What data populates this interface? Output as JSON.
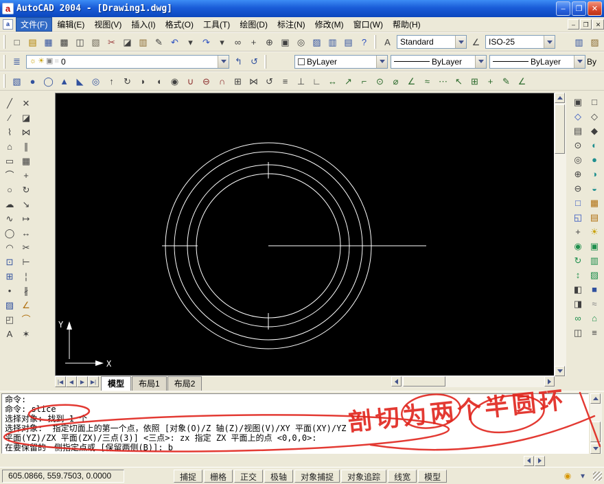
{
  "colors": {
    "titlebar_blue": "#0b47bd",
    "chrome": "#ece9d8",
    "canvas_black": "#000000",
    "annotation_red": "#e0251d",
    "menu_highlight": "#316ac5"
  },
  "title_bar": {
    "title": "AutoCAD 2004 - [Drawing1.dwg]",
    "app_logo_letter": "a"
  },
  "window_controls": {
    "minimize_glyph": "–",
    "restore_glyph": "❐",
    "close_glyph": "✕"
  },
  "menu_bar": {
    "items": [
      {
        "name": "file",
        "label": "文件(F)",
        "highlighted": true
      },
      {
        "name": "edit",
        "label": "编辑(E)"
      },
      {
        "name": "view",
        "label": "视图(V)"
      },
      {
        "name": "insert",
        "label": "插入(I)"
      },
      {
        "name": "format",
        "label": "格式(O)"
      },
      {
        "name": "tools",
        "label": "工具(T)"
      },
      {
        "name": "draw",
        "label": "绘图(D)"
      },
      {
        "name": "dimension",
        "label": "标注(N)"
      },
      {
        "name": "modify",
        "label": "修改(M)"
      },
      {
        "name": "window",
        "label": "窗口(W)"
      },
      {
        "name": "help",
        "label": "帮助(H)"
      }
    ]
  },
  "toolbar_standard": {
    "icons": [
      {
        "name": "new-file",
        "glyph": "□",
        "color": "#404040"
      },
      {
        "name": "open-folder",
        "glyph": "▤",
        "color": "#b08000"
      },
      {
        "name": "save",
        "glyph": "▦",
        "color": "#31519e"
      },
      {
        "name": "plot",
        "glyph": "▩",
        "color": "#404040"
      },
      {
        "name": "print-preview",
        "glyph": "◫",
        "color": "#404040"
      },
      {
        "name": "publish",
        "glyph": "▧",
        "color": "#706a5a"
      },
      {
        "name": "cut",
        "glyph": "✂",
        "color": "#9a3b3b"
      },
      {
        "name": "copy",
        "glyph": "◪",
        "color": "#404040"
      },
      {
        "name": "paste",
        "glyph": "▥",
        "color": "#8a6a30"
      },
      {
        "name": "match-properties",
        "glyph": "✎",
        "color": "#404040"
      },
      {
        "name": "undo",
        "glyph": "↶",
        "color": "#2b4fc0"
      },
      {
        "name": "undo-dropdown",
        "glyph": "▾",
        "color": "#404040"
      },
      {
        "name": "redo",
        "glyph": "↷",
        "color": "#2b4fc0"
      },
      {
        "name": "redo-dropdown",
        "glyph": "▾",
        "color": "#404040"
      },
      {
        "name": "insert-hyperlink",
        "glyph": "∞",
        "color": "#404040"
      },
      {
        "name": "pan-realtime",
        "glyph": "+",
        "color": "#404040"
      },
      {
        "name": "zoom-realtime",
        "glyph": "⊕",
        "color": "#404040"
      },
      {
        "name": "zoom-window",
        "glyph": "▣",
        "color": "#404040"
      },
      {
        "name": "zoom-previous",
        "glyph": "◎",
        "color": "#404040"
      },
      {
        "name": "adcenter",
        "glyph": "▨",
        "color": "#31519e"
      },
      {
        "name": "properties",
        "glyph": "▥",
        "color": "#31519e"
      },
      {
        "name": "tool-palettes",
        "glyph": "▤",
        "color": "#31519e"
      },
      {
        "name": "help",
        "glyph": "?",
        "color": "#2b4fc0"
      }
    ],
    "text_style_icon_glyph": "A",
    "text_style_label": "Standard",
    "dim_style_icon_glyph": "∠",
    "dim_style_label": "ISO-25",
    "overflow_icons": [
      {
        "name": "sheet-set-manager",
        "glyph": "▥",
        "color": "#31519e"
      },
      {
        "name": "markup-set-manager",
        "glyph": "▨",
        "color": "#8a6a30"
      }
    ]
  },
  "toolbar_layers": {
    "icons_left": [
      {
        "name": "layer-properties-manager",
        "glyph": "≣",
        "color": "#31519e"
      }
    ],
    "layer_combo": {
      "state_icons": [
        {
          "name": "layer-on-bulb",
          "glyph": "☼",
          "color": "#c8a000"
        },
        {
          "name": "layer-freeze-sun",
          "glyph": "☀",
          "color": "#c8a000"
        },
        {
          "name": "layer-lock",
          "glyph": "▣",
          "color": "#848484"
        },
        {
          "name": "layer-color-swatch",
          "glyph": "■",
          "color": "#e8e8e8"
        }
      ],
      "value": "0"
    },
    "icons_mid": [
      {
        "name": "make-objects-layer-current",
        "glyph": "↰",
        "color": "#31519e"
      },
      {
        "name": "layer-previous",
        "glyph": "↺",
        "color": "#31519e"
      }
    ],
    "color_combo": {
      "swatch_color": "#ffffff",
      "value": "ByLayer"
    },
    "linetype_combo": {
      "value": "ByLayer"
    },
    "lineweight_combo": {
      "value": "ByLayer"
    },
    "plot_style_fragment": "By"
  },
  "toolbar_row3": {
    "icons": [
      {
        "name": "solid-box",
        "glyph": "▧",
        "color": "#31519e"
      },
      {
        "name": "solid-sphere",
        "glyph": "●",
        "color": "#31519e"
      },
      {
        "name": "solid-cylinder",
        "glyph": "◯",
        "color": "#31519e"
      },
      {
        "name": "solid-cone",
        "glyph": "▲",
        "color": "#31519e"
      },
      {
        "name": "solid-wedge",
        "glyph": "◣",
        "color": "#31519e"
      },
      {
        "name": "solid-torus",
        "glyph": "◎",
        "color": "#31519e"
      },
      {
        "name": "extrude",
        "glyph": "↑",
        "color": "#404040"
      },
      {
        "name": "revolve",
        "glyph": "↻",
        "color": "#404040"
      },
      {
        "name": "slice",
        "glyph": "◗",
        "color": "#404040"
      },
      {
        "name": "section",
        "glyph": "◖",
        "color": "#404040"
      },
      {
        "name": "interfere",
        "glyph": "◉",
        "color": "#404040"
      },
      {
        "name": "union",
        "glyph": "∪",
        "color": "#8a2a2a"
      },
      {
        "name": "subtract",
        "glyph": "⊖",
        "color": "#8a2a2a"
      },
      {
        "name": "intersect",
        "glyph": "∩",
        "color": "#8a2a2a"
      },
      {
        "name": "3d-array",
        "glyph": "⊞",
        "color": "#404040"
      },
      {
        "name": "mirror-3d",
        "glyph": "⋈",
        "color": "#404040"
      },
      {
        "name": "rotate-3d",
        "glyph": "↺",
        "color": "#404040"
      },
      {
        "name": "align",
        "glyph": "≡",
        "color": "#404040"
      },
      {
        "name": "ucs",
        "glyph": "⊥",
        "color": "#404040"
      },
      {
        "name": "named-ucs",
        "glyph": "∟",
        "color": "#404040"
      },
      {
        "name": "dim-linear",
        "glyph": "↔",
        "color": "#2b6a2b"
      },
      {
        "name": "dim-aligned",
        "glyph": "↗",
        "color": "#2b6a2b"
      },
      {
        "name": "dim-ordinate",
        "glyph": "⌐",
        "color": "#2b6a2b"
      },
      {
        "name": "dim-radius",
        "glyph": "⊙",
        "color": "#2b6a2b"
      },
      {
        "name": "dim-diameter",
        "glyph": "⌀",
        "color": "#2b6a2b"
      },
      {
        "name": "dim-angular",
        "glyph": "∠",
        "color": "#2b6a2b"
      },
      {
        "name": "quick-dimension",
        "glyph": "≈",
        "color": "#2b6a2b"
      },
      {
        "name": "continue-dimension",
        "glyph": "⋯",
        "color": "#2b6a2b"
      },
      {
        "name": "quick-leader",
        "glyph": "↖",
        "color": "#2b6a2b"
      },
      {
        "name": "tolerance",
        "glyph": "⊞",
        "color": "#2b6a2b"
      },
      {
        "name": "center-mark",
        "glyph": "+",
        "color": "#2b6a2b"
      },
      {
        "name": "dim-edit",
        "glyph": "✎",
        "color": "#2b6a2b"
      },
      {
        "name": "dim-style",
        "glyph": "∠",
        "color": "#2b6a2b"
      }
    ]
  },
  "left_toolbar_draw": {
    "icons": [
      {
        "name": "line",
        "glyph": "╱",
        "color": "#404040"
      },
      {
        "name": "construction-line",
        "glyph": "∕",
        "color": "#404040"
      },
      {
        "name": "polyline",
        "glyph": "⌇",
        "color": "#404040"
      },
      {
        "name": "polygon",
        "glyph": "⌂",
        "color": "#404040"
      },
      {
        "name": "rectangle",
        "glyph": "▭",
        "color": "#404040"
      },
      {
        "name": "arc",
        "glyph": "⌒",
        "color": "#404040"
      },
      {
        "name": "circle",
        "glyph": "○",
        "color": "#404040"
      },
      {
        "name": "revision-cloud",
        "glyph": "☁",
        "color": "#404040"
      },
      {
        "name": "spline",
        "glyph": "∿",
        "color": "#404040"
      },
      {
        "name": "ellipse",
        "glyph": "◯",
        "color": "#404040"
      },
      {
        "name": "ellipse-arc",
        "glyph": "◠",
        "color": "#404040"
      },
      {
        "name": "insert-block",
        "glyph": "⊡",
        "color": "#31519e"
      },
      {
        "name": "make-block",
        "glyph": "⊞",
        "color": "#31519e"
      },
      {
        "name": "point",
        "glyph": "•",
        "color": "#404040"
      },
      {
        "name": "hatch",
        "glyph": "▨",
        "color": "#31519e"
      },
      {
        "name": "region",
        "glyph": "◰",
        "color": "#404040"
      },
      {
        "name": "mtext",
        "glyph": "A",
        "color": "#404040"
      }
    ]
  },
  "left_toolbar_modify": {
    "icons": [
      {
        "name": "erase",
        "glyph": "✕",
        "color": "#404040"
      },
      {
        "name": "copy-object",
        "glyph": "◪",
        "color": "#404040"
      },
      {
        "name": "mirror",
        "glyph": "⋈",
        "color": "#404040"
      },
      {
        "name": "offset",
        "glyph": "∥",
        "color": "#404040"
      },
      {
        "name": "array",
        "glyph": "▦",
        "color": "#404040"
      },
      {
        "name": "move",
        "glyph": "+",
        "color": "#404040"
      },
      {
        "name": "rotate",
        "glyph": "↻",
        "color": "#404040"
      },
      {
        "name": "scale",
        "glyph": "↘",
        "color": "#404040"
      },
      {
        "name": "stretch",
        "glyph": "↦",
        "color": "#404040"
      },
      {
        "name": "lengthen",
        "glyph": "↔",
        "color": "#404040"
      },
      {
        "name": "trim",
        "glyph": "✂",
        "color": "#404040"
      },
      {
        "name": "extend",
        "glyph": "⊢",
        "color": "#404040"
      },
      {
        "name": "break-at-point",
        "glyph": "¦",
        "color": "#404040"
      },
      {
        "name": "break",
        "glyph": "∦",
        "color": "#404040"
      },
      {
        "name": "chamfer",
        "glyph": "∠",
        "color": "#b07010"
      },
      {
        "name": "fillet",
        "glyph": "⌒",
        "color": "#b07010"
      },
      {
        "name": "explode",
        "glyph": "✶",
        "color": "#404040"
      }
    ]
  },
  "right_toolbar_zoom": {
    "icons": [
      {
        "name": "zoom-window",
        "glyph": "▣",
        "color": "#404040"
      },
      {
        "name": "zoom-dynamic",
        "glyph": "◇",
        "color": "#2b4fc0"
      },
      {
        "name": "zoom-scale",
        "glyph": "▤",
        "color": "#404040"
      },
      {
        "name": "zoom-center",
        "glyph": "⊙",
        "color": "#404040"
      },
      {
        "name": "zoom-object",
        "glyph": "◎",
        "color": "#404040"
      },
      {
        "name": "zoom-in",
        "glyph": "⊕",
        "color": "#404040"
      },
      {
        "name": "zoom-out",
        "glyph": "⊖",
        "color": "#404040"
      },
      {
        "name": "zoom-all",
        "glyph": "□",
        "color": "#2b4fc0"
      },
      {
        "name": "zoom-extents",
        "glyph": "◱",
        "color": "#2b4fc0"
      },
      {
        "name": "pan-point",
        "glyph": "+",
        "color": "#404040"
      },
      {
        "name": "3d-orbit",
        "glyph": "◉",
        "color": "#1f8f4d"
      },
      {
        "name": "3d-swivel",
        "glyph": "↻",
        "color": "#1f8f4d"
      },
      {
        "name": "3d-adjust-distance",
        "glyph": "↕",
        "color": "#1f8f4d"
      },
      {
        "name": "3d-clip-front",
        "glyph": "◧",
        "color": "#404040"
      },
      {
        "name": "3d-clip-back",
        "glyph": "◨",
        "color": "#404040"
      },
      {
        "name": "continuous-orbit",
        "glyph": "∞",
        "color": "#1f8f4d"
      },
      {
        "name": "camera",
        "glyph": "◫",
        "color": "#404040"
      }
    ]
  },
  "right_toolbar_shade": {
    "icons": [
      {
        "name": "2d-wireframe",
        "glyph": "□",
        "color": "#404040"
      },
      {
        "name": "3d-wireframe",
        "glyph": "◇",
        "color": "#404040"
      },
      {
        "name": "hidden",
        "glyph": "◆",
        "color": "#404040"
      },
      {
        "name": "flat-shaded",
        "glyph": "◐",
        "color": "#1f8f8f"
      },
      {
        "name": "gouraud-shaded",
        "glyph": "●",
        "color": "#1f8f8f"
      },
      {
        "name": "flat-shaded-edges",
        "glyph": "◑",
        "color": "#1f8f8f"
      },
      {
        "name": "gouraud-shaded-edges",
        "glyph": "◒",
        "color": "#1f8f8f"
      },
      {
        "name": "render",
        "glyph": "▦",
        "color": "#b07010"
      },
      {
        "name": "scenes",
        "glyph": "▤",
        "color": "#b07010"
      },
      {
        "name": "lights",
        "glyph": "☀",
        "color": "#c8a000"
      },
      {
        "name": "materials",
        "glyph": "▣",
        "color": "#1f8f4d"
      },
      {
        "name": "materials-library",
        "glyph": "▥",
        "color": "#1f8f4d"
      },
      {
        "name": "mapping",
        "glyph": "▨",
        "color": "#1f8f4d"
      },
      {
        "name": "background",
        "glyph": "■",
        "color": "#31519e"
      },
      {
        "name": "fog",
        "glyph": "≈",
        "color": "#848484"
      },
      {
        "name": "landscape-new",
        "glyph": "⌂",
        "color": "#1f8f4d"
      },
      {
        "name": "render-statistics",
        "glyph": "≡",
        "color": "#404040"
      }
    ]
  },
  "canvas": {
    "ucs": {
      "x_label": "X",
      "y_label": "Y"
    }
  },
  "layout_tabs": {
    "nav_icons": [
      {
        "name": "first-tab",
        "glyph": "|◀"
      },
      {
        "name": "prev-tab",
        "glyph": "◀"
      },
      {
        "name": "next-tab",
        "glyph": "▶"
      },
      {
        "name": "last-tab",
        "glyph": "▶|"
      }
    ],
    "tabs": [
      {
        "name": "model",
        "label": "模型",
        "active": true
      },
      {
        "name": "layout1",
        "label": "布局1"
      },
      {
        "name": "layout2",
        "label": "布局2"
      }
    ]
  },
  "command_window": {
    "lines": [
      "命令:",
      "命令: slice",
      "选择对象: 找到 1 个",
      "选择对象:  指定切面上的第一个点，依照 [对象(O)/Z 轴(Z)/视图(V)/XY 平面(XY)/YZ",
      "平面(YZ)/ZX 平面(ZX)/三点(3)] <三点>: zx 指定 ZX 平面上的点 <0,0,0>:",
      "在要保留的一侧指定点或 [保留两侧(B)]: b"
    ]
  },
  "annotations": {
    "handwriting": "剖切为两个半圆环",
    "color": "#e0251d"
  },
  "status_bar": {
    "coords": "605.0866, 559.7503, 0.0000",
    "buttons": [
      {
        "name": "snap",
        "label": "捕捉"
      },
      {
        "name": "grid",
        "label": "栅格"
      },
      {
        "name": "ortho",
        "label": "正交"
      },
      {
        "name": "polar",
        "label": "极轴"
      },
      {
        "name": "osnap",
        "label": "对象捕捉"
      },
      {
        "name": "otrack",
        "label": "对象追踪"
      },
      {
        "name": "lineweight",
        "label": "线宽"
      },
      {
        "name": "model-space",
        "label": "模型"
      }
    ],
    "tray_icons": [
      {
        "name": "communication-center",
        "glyph": "◉",
        "color": "#d79600"
      },
      {
        "name": "status-menu-arrow",
        "glyph": "▾",
        "color": "#44548c"
      }
    ]
  }
}
